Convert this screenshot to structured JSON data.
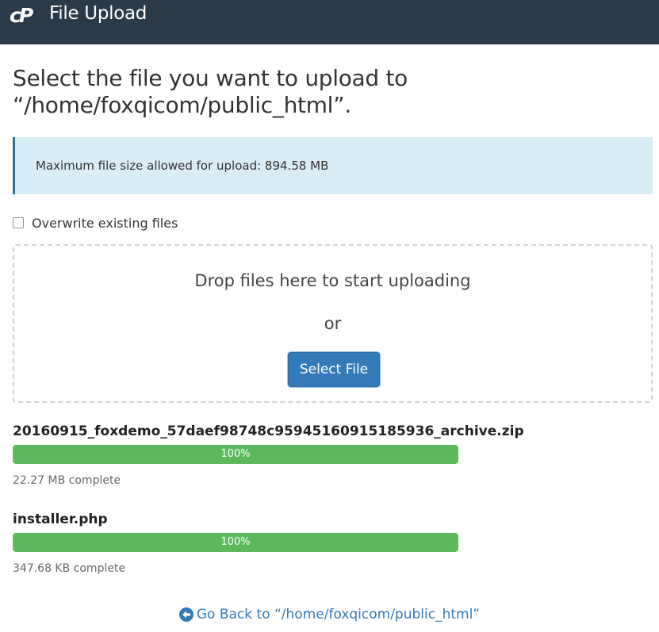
{
  "app": {
    "title": "File Upload",
    "logo_text": "cP"
  },
  "heading": "Select the file you want to upload to “/home/foxqicom/public_html”.",
  "info": {
    "text": "Maximum file size allowed for upload: 894.58 MB"
  },
  "overwrite": {
    "label": "Overwrite existing files",
    "checked": false
  },
  "dropzone": {
    "drop_text": "Drop files here to start uploading",
    "or_text": "or",
    "button_label": "Select File"
  },
  "uploads": [
    {
      "name": "20160915_foxdemo_57daef98748c95945160915185936_archive.zip",
      "progress_label": "100%",
      "progress": 100,
      "status": "22.27 MB complete"
    },
    {
      "name": "installer.php",
      "progress_label": "100%",
      "progress": 100,
      "status": "347.68 KB complete"
    }
  ],
  "go_back": {
    "label": "Go Back to “/home/foxqicom/public_html”"
  },
  "colors": {
    "header_bg": "#293a4a",
    "info_bg": "#d9edf7",
    "primary": "#337ab7",
    "progress": "#5cb85c"
  },
  "icons": {
    "logo": "cpanel-logo-icon",
    "back": "arrow-left-circle-icon"
  }
}
